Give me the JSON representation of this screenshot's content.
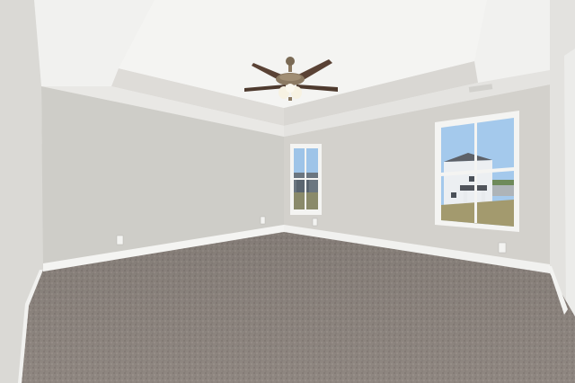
{
  "scene": {
    "subject": "empty-bedroom",
    "palette": {
      "ceiling": "#f3f3f1",
      "tray": "#e6e6e3",
      "wall_back": "#cfcdc8",
      "wall_left": "#dad9d5",
      "wall_right": "#d5d3ce",
      "baseboard": "#f4f4f2",
      "carpet": "#8d847f",
      "sky": "#9ec4e8",
      "fan_blade": "#5a4235",
      "fan_metal": "#8c7a62"
    }
  }
}
